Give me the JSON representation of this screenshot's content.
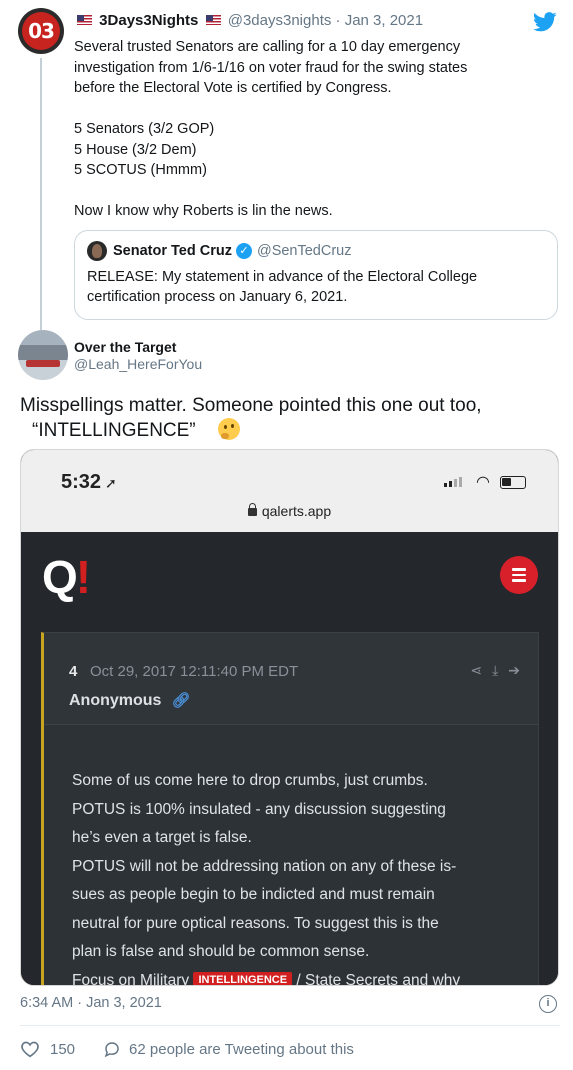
{
  "tweet1": {
    "avatar_text": "03",
    "display_name": "3Days3Nights",
    "handle_date": "@3days3nights · Jan 3, 2021",
    "lines": [
      "Several trusted Senators are calling for a 10 day emergency",
      "investigation from 1/6-1/16 on voter fraud for the swing states",
      "before the Electoral Vote is certified by Congress."
    ],
    "list": [
      "5 Senators (3/2 GOP)",
      "5 House (3/2 Dem)",
      "5 SCOTUS (Hmmm)"
    ],
    "closing": "Now I know why Roberts is lin the news.",
    "quote": {
      "name": "Senator Ted Cruz",
      "handle": "@SenTedCruz",
      "text_lines": [
        "RELEASE: My statement in advance of the Electoral College",
        "certification process on January 6, 2021."
      ]
    }
  },
  "tweet2": {
    "display_name": "Over the Target",
    "handle": "@Leah_HereForYou",
    "line1": "Misspellings matter. Someone pointed this one out too,",
    "line2": "“INTELLINGENCE”",
    "timestamp": "6:34 AM · Jan 3, 2021",
    "likes": "150",
    "tweeting": "62 people are Tweeting about this"
  },
  "screenshot": {
    "time": "5:32",
    "url": "qalerts.app",
    "logo": "Q",
    "logo_mark": "!",
    "post_number": "4",
    "post_date": "Oct 29, 2017 12:11:40 PM EDT",
    "author": "Anonymous",
    "lines": [
      "Some of us come here to drop crumbs, just crumbs.",
      "POTUS is 100% insulated - any discussion suggesting",
      "he’s even a target is false.",
      "POTUS will not be addressing nation on any of these is-",
      "sues as people begin to be indicted and must remain",
      "neutral for pure optical reasons. To suggest this is the",
      "plan is false and should be common sense."
    ],
    "last_line_prefix": "Focus on Military ",
    "tag": "INTELLINGENCE",
    "last_line_suffix": " / State Secrets and why"
  },
  "colors": {
    "link_blue": "#1da1f2",
    "q_red": "#d21f1f",
    "dark_bg": "#24272b",
    "accent_gold": "#c9a41f"
  },
  "icons": [
    "twitter-bird-icon",
    "flag-icon",
    "verified-icon",
    "location-arrow-icon",
    "wifi-icon",
    "battery-icon",
    "lock-icon",
    "menu-icon",
    "share-icon",
    "download-icon",
    "arrow-icon",
    "link-icon",
    "info-icon",
    "heart-icon",
    "comment-icon",
    "thinking-emoji-icon"
  ]
}
